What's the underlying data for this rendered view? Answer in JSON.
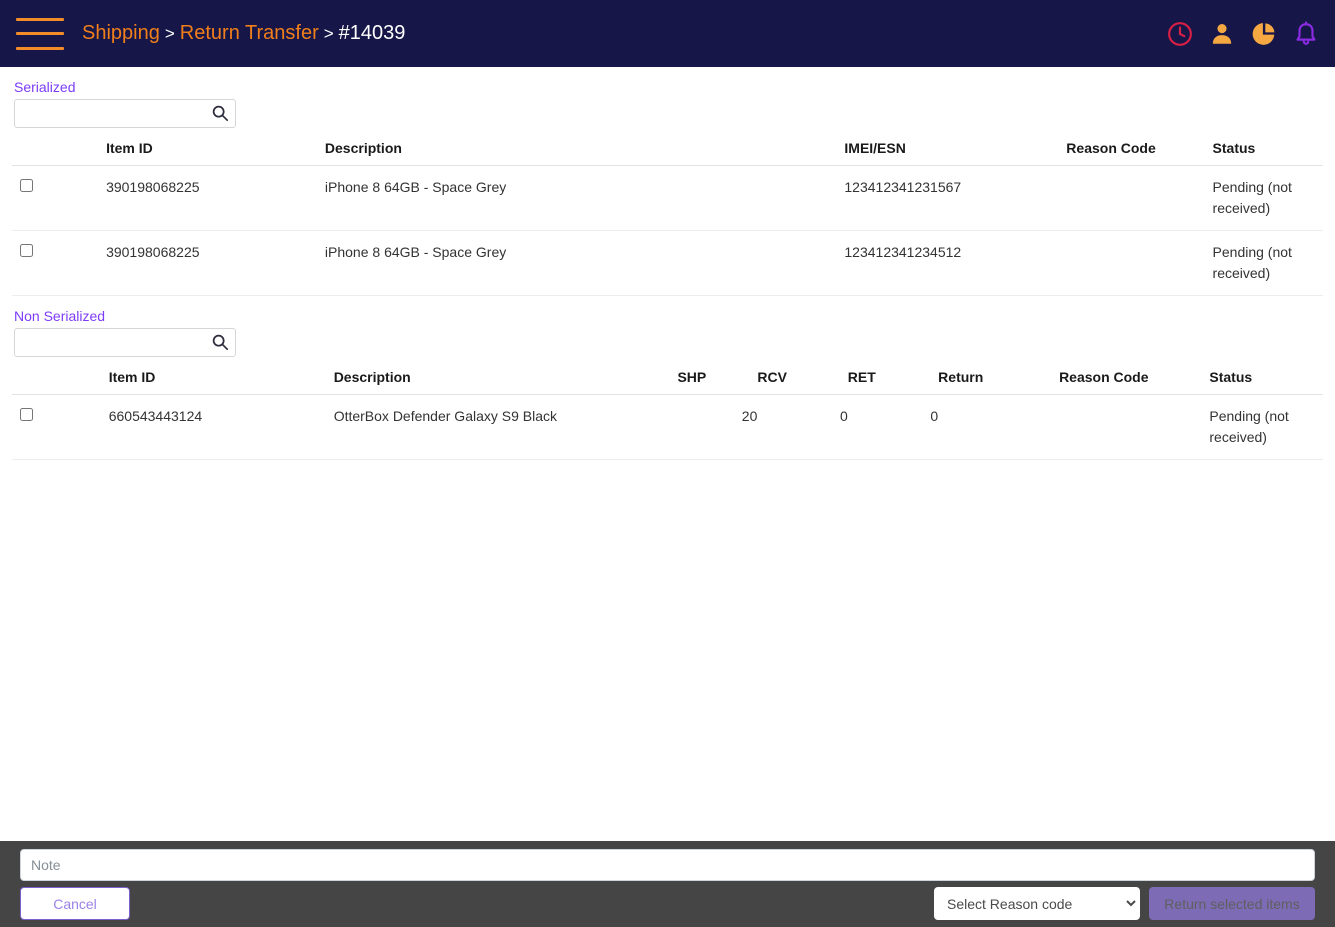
{
  "topbar": {
    "menu_icon": "hamburger-menu-icon",
    "breadcrumb": {
      "level1": "Shipping",
      "sep1": ">",
      "level2": "Return Transfer",
      "sep2": ">",
      "current": "#14039"
    },
    "icons": [
      {
        "name": "clock-icon",
        "color": "#d81f45"
      },
      {
        "name": "user-icon",
        "color": "#f5a742"
      },
      {
        "name": "pie-chart-icon",
        "color": "#f5a742"
      },
      {
        "name": "bell-icon",
        "color": "#8a2be2"
      }
    ]
  },
  "serialized": {
    "label": "Serialized",
    "search_placeholder": "",
    "search_value": "",
    "columns": [
      "",
      "Item ID",
      "Description",
      "IMEI/ESN",
      "Reason Code",
      "Status"
    ],
    "rows": [
      {
        "item_id": "390198068225",
        "description": "iPhone 8 64GB - Space Grey",
        "imei": "123412341231567",
        "reason_code": "",
        "status": "Pending (not received)"
      },
      {
        "item_id": "390198068225",
        "description": "iPhone 8 64GB - Space Grey",
        "imei": "123412341234512",
        "reason_code": "",
        "status": "Pending (not received)"
      }
    ]
  },
  "non_serialized": {
    "label": "Non Serialized",
    "search_placeholder": "",
    "search_value": "",
    "columns": [
      "",
      "Item ID",
      "Description",
      "SHP",
      "RCV",
      "RET",
      "Return",
      "Reason Code",
      "Status"
    ],
    "rows": [
      {
        "item_id": "660543443124",
        "description": "OtterBox Defender Galaxy S9 Black",
        "shp": "20",
        "rcv": "0",
        "ret": "0",
        "return": "",
        "reason_code": "",
        "status": "Pending (not received)"
      }
    ]
  },
  "footer": {
    "note_placeholder": "Note",
    "note_value": "",
    "cancel_label": "Cancel",
    "reason_select_value": "Select Reason code",
    "return_label": "Return selected items"
  },
  "colors": {
    "topbar_bg": "#161748",
    "accent_orange": "#f07e1a",
    "section_purple": "#7d3cf8",
    "footer_bg": "#454545",
    "button_purple": "#7e6bb5"
  }
}
